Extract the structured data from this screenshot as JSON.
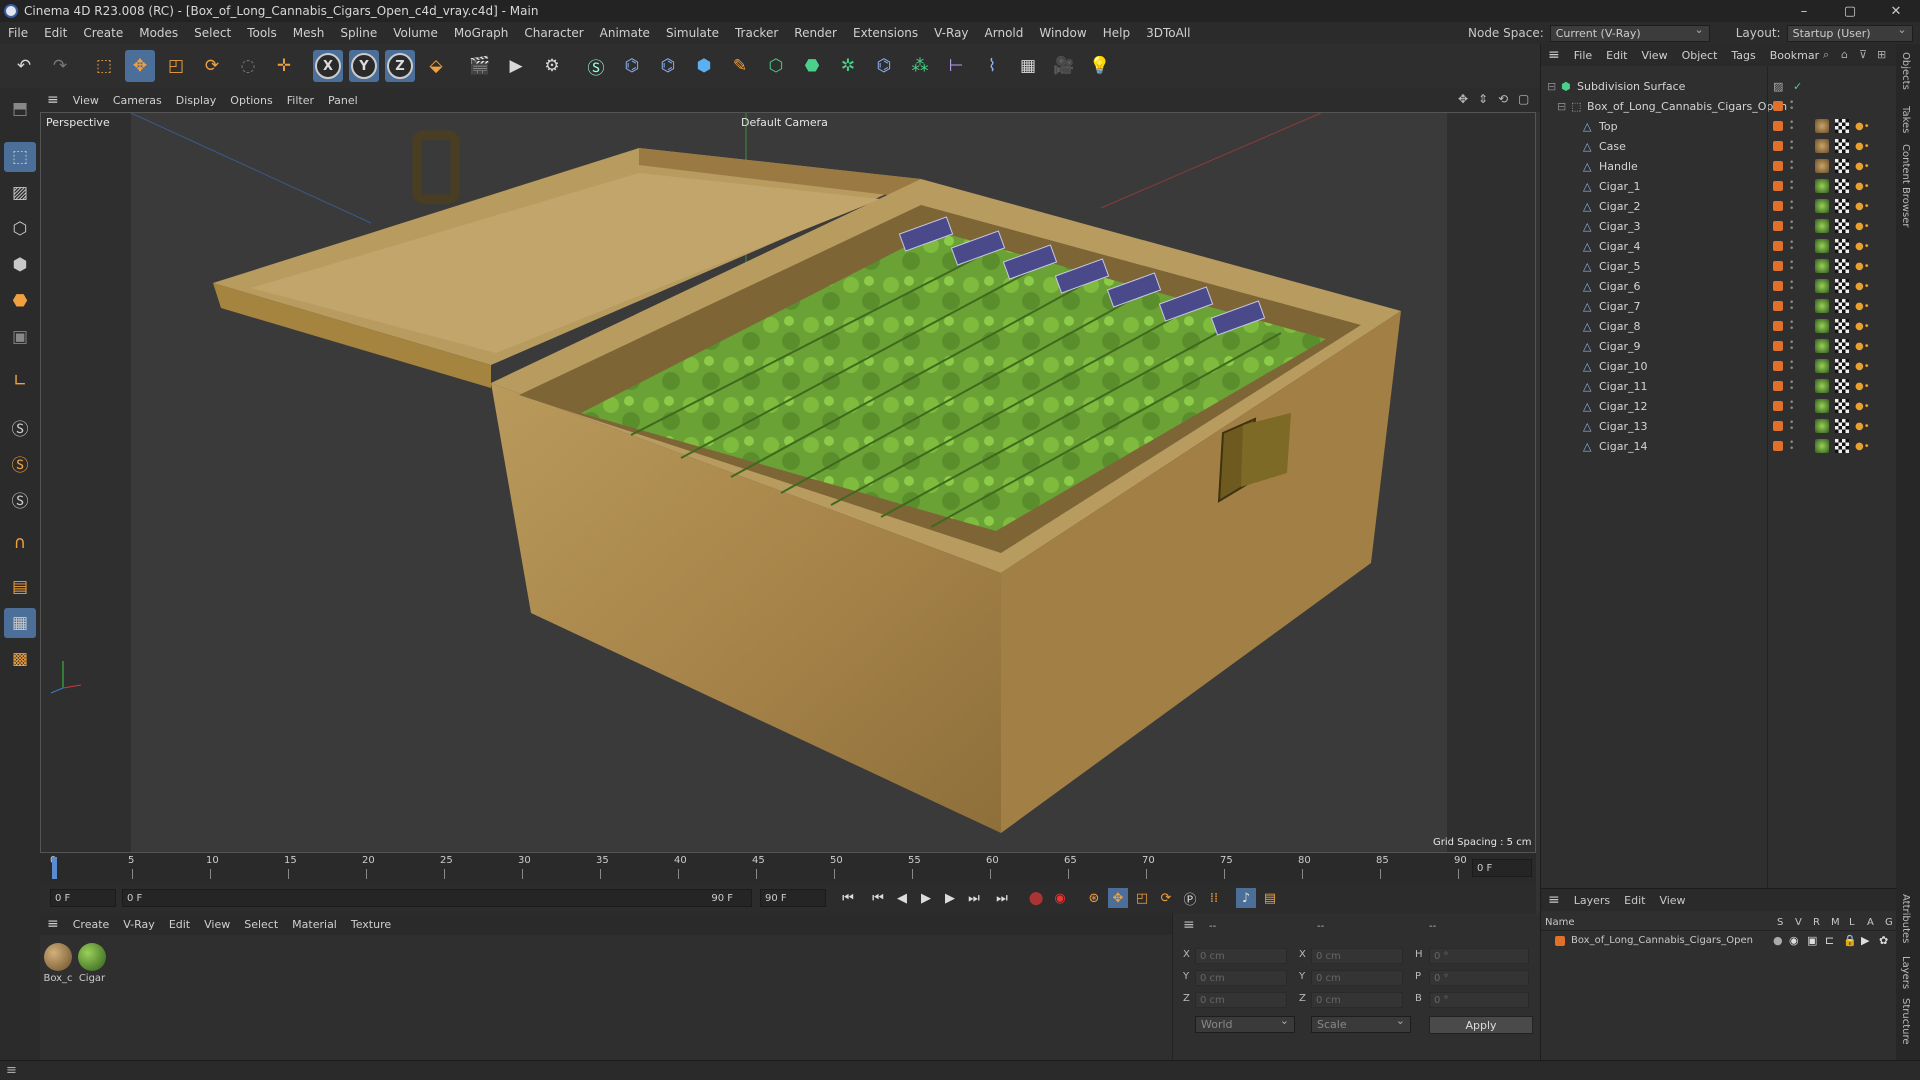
{
  "window": {
    "title": "Cinema 4D R23.008 (RC) - [Box_of_Long_Cannabis_Cigars_Open_c4d_vray.c4d] - Main",
    "controls": [
      "–",
      "▢",
      "✕"
    ]
  },
  "menu": {
    "items": [
      "File",
      "Edit",
      "Create",
      "Modes",
      "Select",
      "Tools",
      "Mesh",
      "Spline",
      "Volume",
      "MoGraph",
      "Character",
      "Animate",
      "Simulate",
      "Tracker",
      "Render",
      "Extensions",
      "V-Ray",
      "Arnold",
      "Window",
      "Help",
      "3DToAll"
    ],
    "node_space_label": "Node Space:",
    "node_space_value": "Current (V-Ray)",
    "layout_label": "Layout:",
    "layout_value": "Startup (User)"
  },
  "toolbar": {
    "axis_x": "X",
    "axis_y": "Y",
    "axis_z": "Z"
  },
  "viewport": {
    "menu": [
      "View",
      "Cameras",
      "Display",
      "Options",
      "Filter",
      "Panel"
    ],
    "label": "Perspective",
    "camera": "Default Camera",
    "grid_spacing": "Grid Spacing : 5 cm"
  },
  "timeline": {
    "ticks": [
      "0",
      "5",
      "10",
      "15",
      "20",
      "25",
      "30",
      "35",
      "40",
      "45",
      "50",
      "55",
      "60",
      "65",
      "70",
      "75",
      "80",
      "85",
      "90"
    ],
    "current_frame_right": "0 F",
    "start_field": "0 F",
    "range_start": "0 F",
    "range_end": "90 F",
    "end_field": "90 F"
  },
  "material_panel": {
    "menu": [
      "Create",
      "V-Ray",
      "Edit",
      "View",
      "Select",
      "Material",
      "Texture"
    ],
    "materials": [
      {
        "name": "Box_c",
        "color": "#9a7a4a"
      },
      {
        "name": "Cigar",
        "color": "#5a9a3a"
      }
    ]
  },
  "attributes": {
    "rows": [
      {
        "a": "X",
        "av": "0 cm",
        "b": "X",
        "bv": "0 cm",
        "c": "H",
        "cv": "0 °"
      },
      {
        "a": "Y",
        "av": "0 cm",
        "b": "Y",
        "bv": "0 cm",
        "c": "P",
        "cv": "0 °"
      },
      {
        "a": "Z",
        "av": "0 cm",
        "b": "Z",
        "bv": "0 cm",
        "c": "B",
        "cv": "0 °"
      }
    ],
    "coord_mode": "World",
    "scale_mode": "Scale",
    "apply": "Apply",
    "dash1": "--",
    "dash2": "--",
    "dash3": "--"
  },
  "objects_panel": {
    "menu": [
      "File",
      "Edit",
      "View",
      "Object",
      "Tags",
      "Bookmar"
    ],
    "root": "Subdivision Surface",
    "group": "Box_of_Long_Cannabis_Cigars_Open",
    "children": [
      "Top",
      "Case",
      "Handle",
      "Cigar_1",
      "Cigar_2",
      "Cigar_3",
      "Cigar_4",
      "Cigar_5",
      "Cigar_6",
      "Cigar_7",
      "Cigar_8",
      "Cigar_9",
      "Cigar_10",
      "Cigar_11",
      "Cigar_12",
      "Cigar_13",
      "Cigar_14"
    ]
  },
  "layers_panel": {
    "menu": [
      "Layers",
      "Edit",
      "View"
    ],
    "col_name": "Name",
    "cols": [
      "S",
      "V",
      "R",
      "M",
      "L",
      "A",
      "G"
    ],
    "layer": "Box_of_Long_Cannabis_Cigars_Open"
  },
  "side_tabs": [
    "Objects",
    "Takes",
    "Content Browser",
    "Attributes",
    "Layers",
    "Structure"
  ]
}
